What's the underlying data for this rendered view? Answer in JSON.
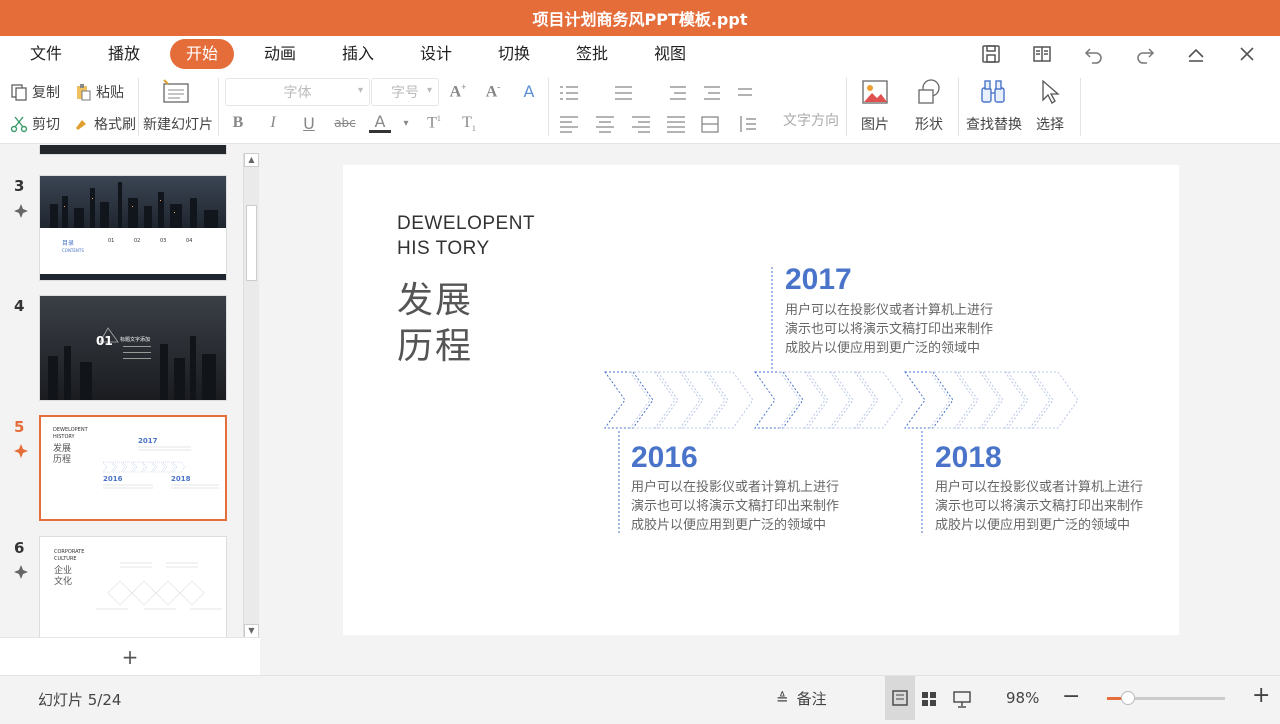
{
  "title": "项目计划商务风PPT模板.ppt",
  "menu": [
    "文件",
    "播放",
    "开始",
    "动画",
    "插入",
    "设计",
    "切换",
    "签批",
    "视图"
  ],
  "menu_active": "开始",
  "ribbon": {
    "copy": "复制",
    "paste": "粘贴",
    "cut": "剪切",
    "format_painter": "格式刷",
    "new_slide": "新建幻灯片",
    "font_placeholder": "字体",
    "size_placeholder": "字号",
    "text_direction": "文字方向",
    "picture": "图片",
    "shape": "形状",
    "find_replace": "查找替换",
    "select": "选择"
  },
  "slides": [
    {
      "num": "3",
      "caption": "目录",
      "caption2": "CONTENTS",
      "items": [
        "01",
        "02",
        "03",
        "04"
      ]
    },
    {
      "num": "4",
      "badge": "01",
      "caption": "标题文字添加"
    },
    {
      "num": "5",
      "title1": "DEWELOPENT",
      "title2": "HISTORY",
      "cn": "发展",
      "cn2": "历程",
      "years": [
        "2017",
        "2016",
        "2018"
      ]
    },
    {
      "num": "6",
      "title1": "CORPORATE",
      "title2": "CULTURE",
      "cn": "企业",
      "cn2": "文化"
    }
  ],
  "canvas": {
    "title_line1": "DEWELOPENT",
    "title_line2": "HIS TORY",
    "cn_line1": "发展",
    "cn_line2": "历程",
    "milestones": [
      {
        "year": "2017",
        "text": "用户可以在投影仪或者计算机上进行演示也可以将演示文稿打印出来制作成胶片以便应用到更广泛的领域中"
      },
      {
        "year": "2016",
        "text": "用户可以在投影仪或者计算机上进行演示也可以将演示文稿打印出来制作成胶片以便应用到更广泛的领域中"
      },
      {
        "year": "2018",
        "text": "用户可以在投影仪或者计算机上进行演示也可以将演示文稿打印出来制作成胶片以便应用到更广泛的领域中"
      }
    ]
  },
  "status": {
    "slide_counter": "幻灯片 5/24",
    "notes": "备注",
    "zoom": "98%"
  },
  "colors": {
    "accent": "#e56d3a",
    "blue": "#4a74c9"
  }
}
